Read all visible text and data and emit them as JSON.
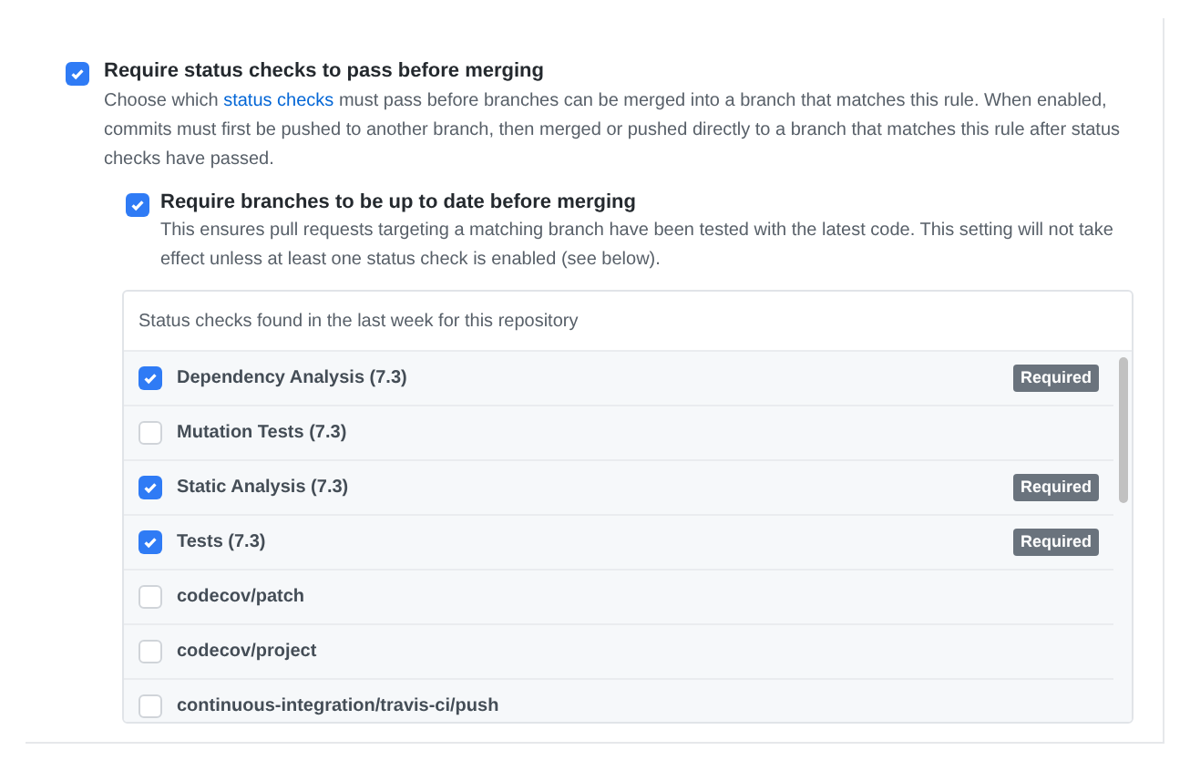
{
  "rule": {
    "checked": true,
    "title": "Require status checks to pass before merging",
    "description_before": "Choose which",
    "link": "status checks",
    "description_after": "must pass before branches can be merged into a branch that matches this rule. When enabled, commits must first be pushed to another branch, then merged or pushed directly to a branch that matches this rule after status checks have passed."
  },
  "sub_rule": {
    "checked": true,
    "title": "Require branches to be up to date before merging",
    "description": "This ensures pull requests targeting a matching branch have been tested with the latest code. This setting will not take effect unless at least one status check is enabled (see below)."
  },
  "status_checks": {
    "header": "Status checks found in the last week for this repository",
    "items": [
      {
        "name": "Dependency Analysis (7.3)",
        "checked": true,
        "badge": "Required"
      },
      {
        "name": "Mutation Tests (7.3)",
        "checked": false
      },
      {
        "name": "Static Analysis (7.3)",
        "checked": true,
        "badge": "Required"
      },
      {
        "name": "Tests (7.3)",
        "checked": true,
        "badge": "Required"
      },
      {
        "name": "codecov/patch",
        "checked": false
      },
      {
        "name": "codecov/project",
        "checked": false
      },
      {
        "name": "continuous-integration/travis-ci/push",
        "checked": false
      }
    ]
  }
}
